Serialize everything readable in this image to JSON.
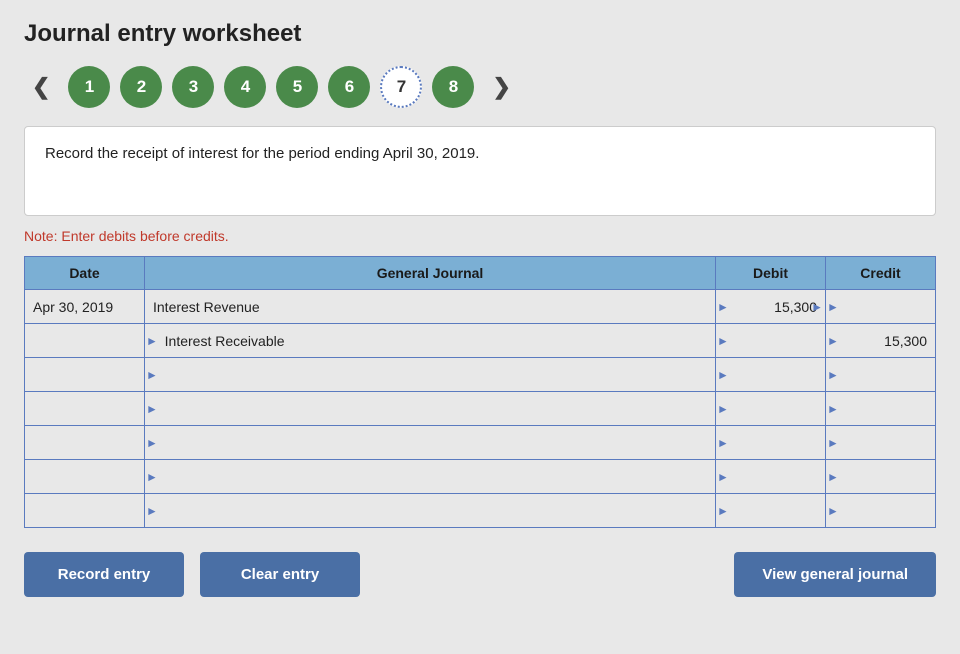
{
  "page": {
    "title": "Journal entry worksheet"
  },
  "nav": {
    "prev_label": "❮",
    "next_label": "❯",
    "steps": [
      {
        "number": "1",
        "active": false
      },
      {
        "number": "2",
        "active": false
      },
      {
        "number": "3",
        "active": false
      },
      {
        "number": "4",
        "active": false
      },
      {
        "number": "5",
        "active": false
      },
      {
        "number": "6",
        "active": false
      },
      {
        "number": "7",
        "active": true
      },
      {
        "number": "8",
        "active": false
      }
    ]
  },
  "instruction": {
    "text": "Record the receipt of interest for the period ending April 30, 2019."
  },
  "note": {
    "text": "Note: Enter debits before credits."
  },
  "table": {
    "headers": {
      "date": "Date",
      "journal": "General Journal",
      "debit": "Debit",
      "credit": "Credit"
    },
    "rows": [
      {
        "date": "Apr 30, 2019",
        "journal": "Interest Revenue",
        "debit": "15,300",
        "credit": "",
        "indent": false
      },
      {
        "date": "",
        "journal": "Interest Receivable",
        "debit": "",
        "credit": "15,300",
        "indent": true
      },
      {
        "date": "",
        "journal": "",
        "debit": "",
        "credit": "",
        "indent": false
      },
      {
        "date": "",
        "journal": "",
        "debit": "",
        "credit": "",
        "indent": false
      },
      {
        "date": "",
        "journal": "",
        "debit": "",
        "credit": "",
        "indent": false
      },
      {
        "date": "",
        "journal": "",
        "debit": "",
        "credit": "",
        "indent": false
      },
      {
        "date": "",
        "journal": "",
        "debit": "",
        "credit": "",
        "indent": false
      }
    ]
  },
  "buttons": {
    "record": "Record entry",
    "clear": "Clear entry",
    "view": "View general journal"
  }
}
